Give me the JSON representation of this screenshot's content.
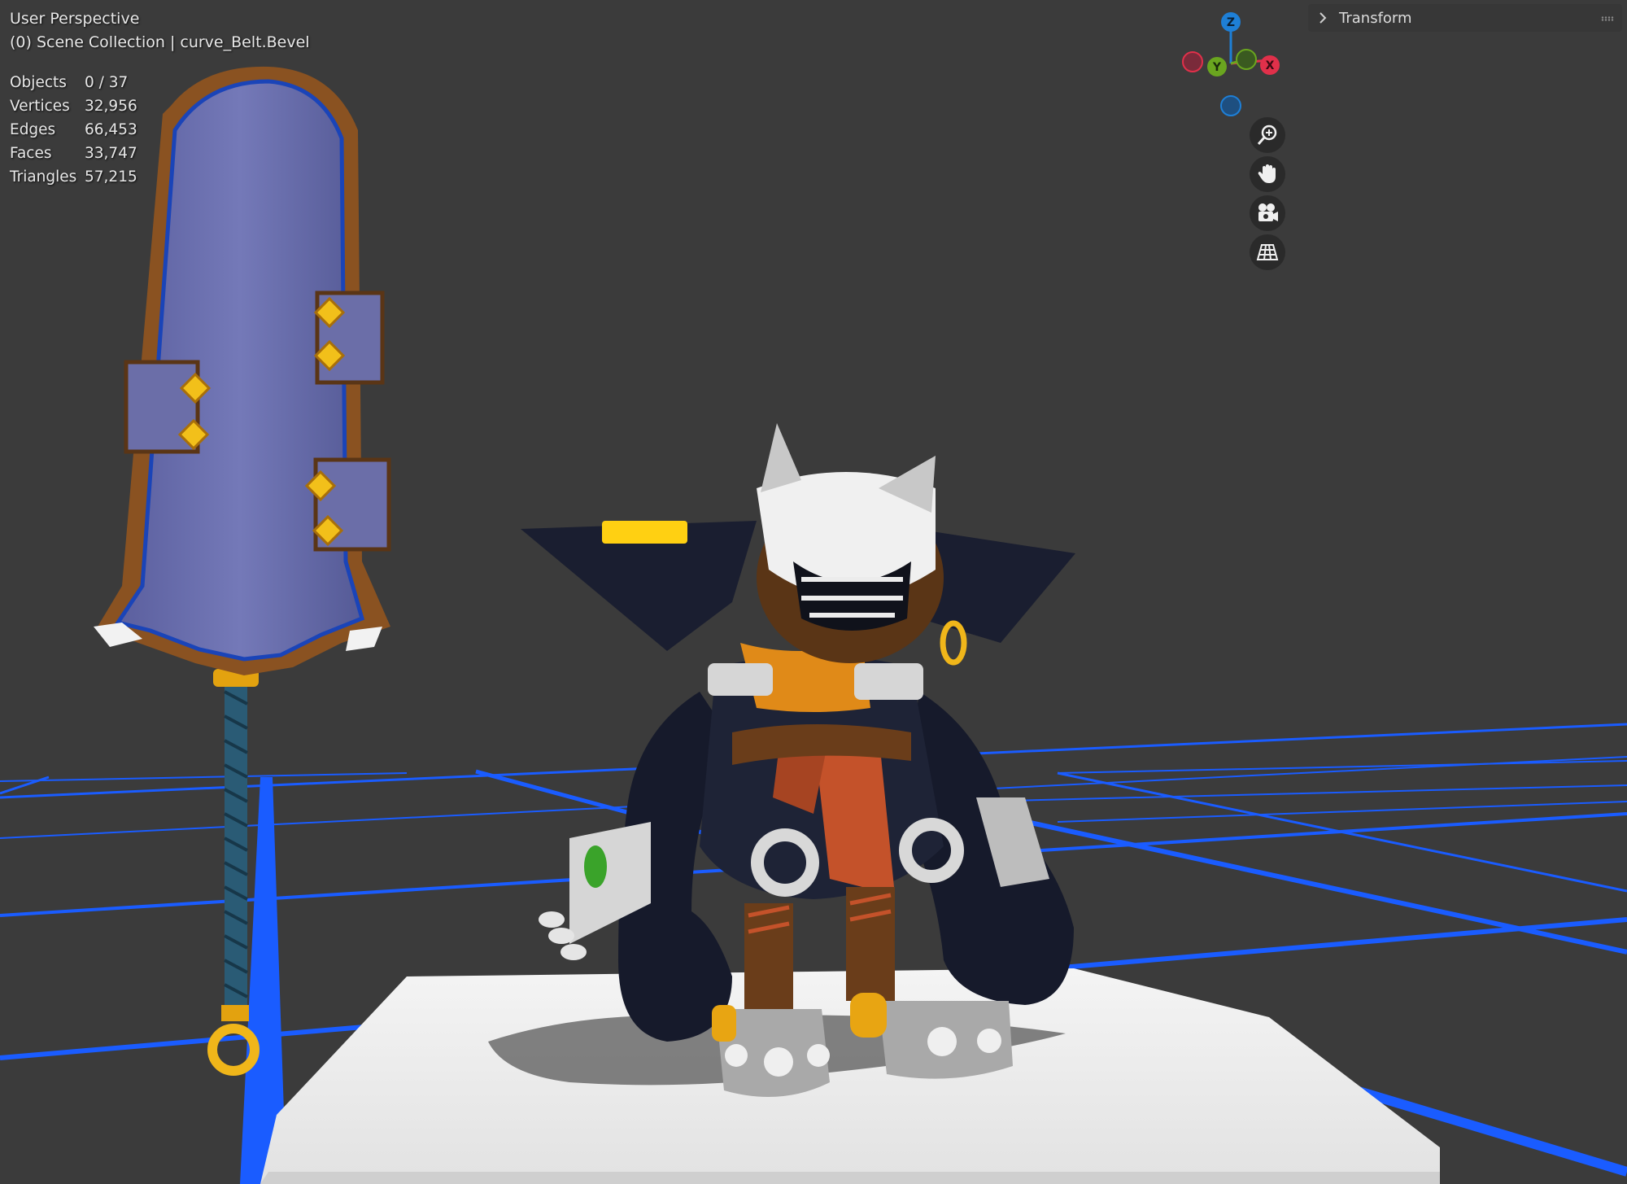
{
  "viewport": {
    "view_name": "User Perspective",
    "collection_info": "(0) Scene Collection | curve_Belt.Bevel",
    "background_color": "#3b3b3b",
    "grid_color": "#1a5cff"
  },
  "stats": [
    {
      "label": "Objects",
      "value": "0 / 37"
    },
    {
      "label": "Vertices",
      "value": "32,956"
    },
    {
      "label": "Edges",
      "value": "66,453"
    },
    {
      "label": "Faces",
      "value": "33,747"
    },
    {
      "label": "Triangles",
      "value": "57,215"
    }
  ],
  "gizmo": {
    "z_label": "Z",
    "y_label": "Y",
    "x_label": "X",
    "x_color": "#e0304a",
    "y_color": "#6aa51f",
    "z_color": "#1e7fd6"
  },
  "nav_buttons": [
    {
      "icon": "zoom-icon"
    },
    {
      "icon": "pan-hand-icon"
    },
    {
      "icon": "camera-icon"
    },
    {
      "icon": "perspective-grid-icon"
    }
  ],
  "side_panel": {
    "title": "Transform"
  }
}
